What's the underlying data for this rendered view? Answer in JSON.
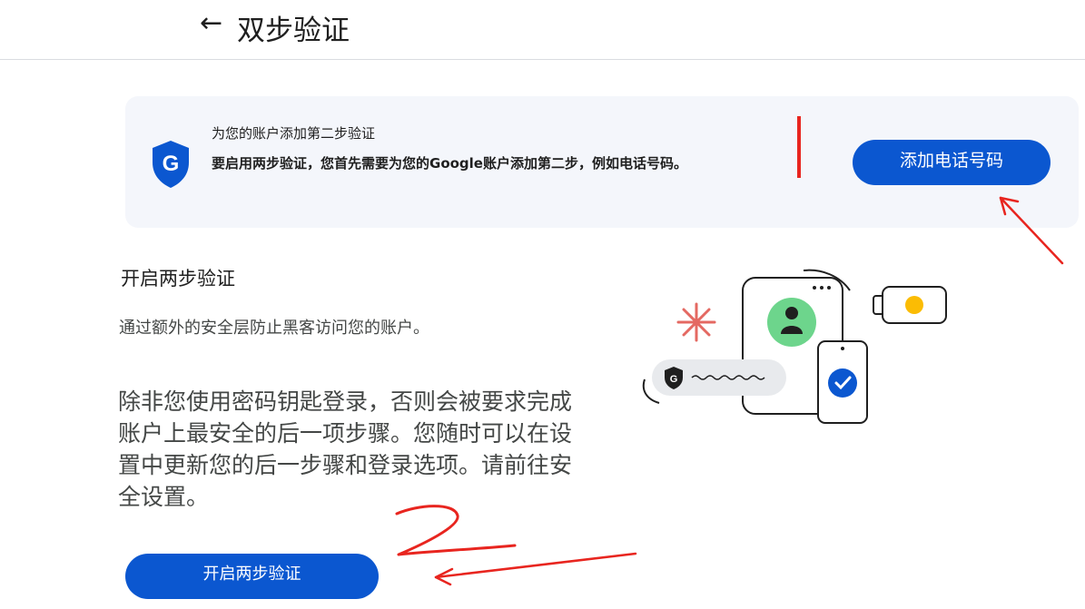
{
  "header": {
    "back_arrow": "←",
    "title": "双步验证"
  },
  "banner": {
    "title": "为您的账户添加第二步验证",
    "description": "要启用两步验证，您首先需要为您的Google账户添加第二步，例如电话号码。",
    "button_label": "添加电话号码",
    "icon": "google-shield-icon"
  },
  "section": {
    "title": "开启两步验证",
    "description": "通过额外的安全层防止黑客访问您的账户。",
    "body": "除非您使用密码钥匙登录，否则会被要求完成账户上最安全的后一项步骤。您随时可以在设置中更新您的后一步骤和登录选项。请前往安全设置。",
    "button_label": "开启两步验证"
  },
  "colors": {
    "primary": "#0b57d0",
    "annotation_red": "#e8251f",
    "banner_bg": "#f4f6fb",
    "illustration_green": "#6dd58c",
    "illustration_yellow": "#fbbc04"
  }
}
